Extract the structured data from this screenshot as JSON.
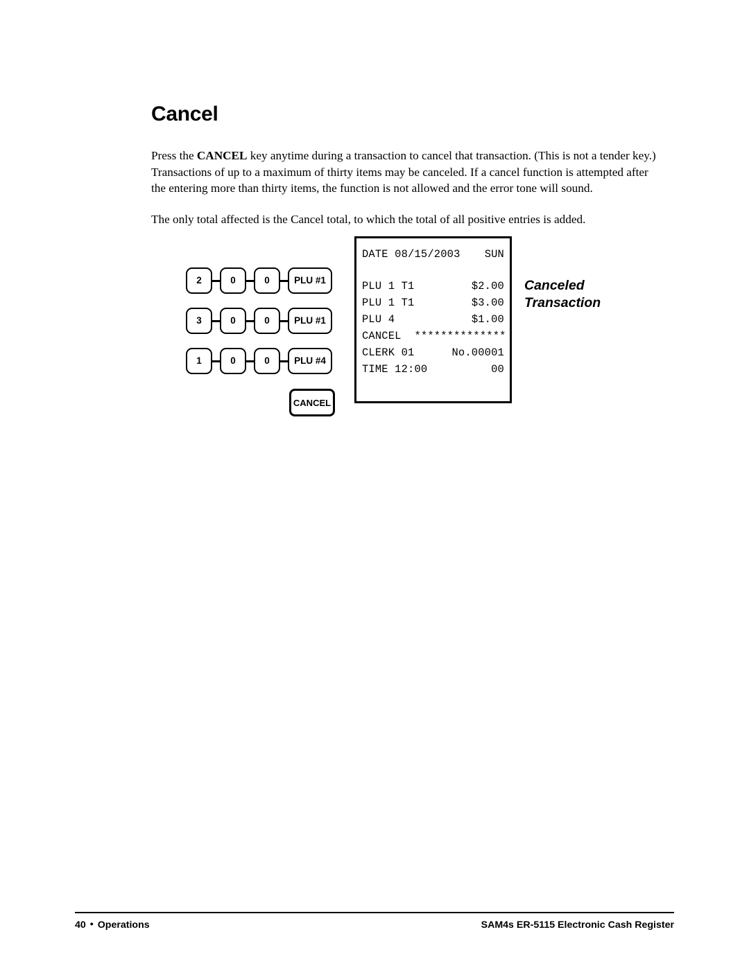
{
  "page": {
    "heading": "Cancel",
    "paragraphs": {
      "p1_before_bold": "Press the ",
      "p1_bold": "CANCEL",
      "p1_after_bold": " key anytime during a transaction to cancel that transaction.  (This is not a tender key.)  Transactions of up to a maximum of thirty items may be canceled.  If a cancel function is attempted after the entering more than thirty items, the function is not allowed and the error tone will sound.",
      "p2": "The only total affected is the Cancel total, to which the total of all positive entries is added."
    }
  },
  "keypad": {
    "rows": [
      {
        "keys": [
          "2",
          "0",
          "0",
          "PLU #1"
        ]
      },
      {
        "keys": [
          "3",
          "0",
          "0",
          "PLU #1"
        ]
      },
      {
        "keys": [
          "1",
          "0",
          "0",
          "PLU #4"
        ]
      }
    ],
    "cancel_key": "CANCEL"
  },
  "receipt": {
    "lines": [
      {
        "left": "DATE 08/15/2003",
        "right": "SUN"
      },
      {
        "left": "PLU 1 T1",
        "right": "$2.00"
      },
      {
        "left": "PLU 1 T1",
        "right": "$3.00"
      },
      {
        "left": "PLU 4",
        "right": "$1.00"
      },
      {
        "left": "CANCEL  **************",
        "right": ""
      },
      {
        "left": "CLERK 01",
        "right": "No.00001"
      },
      {
        "left": "TIME 12:00",
        "right": "00"
      }
    ]
  },
  "callout": {
    "text": "Canceled\nTransaction"
  },
  "footer": {
    "page_number": "40",
    "bullet": "•",
    "section": "Operations",
    "product": "SAM4s ER-5115 Electronic Cash Register"
  }
}
